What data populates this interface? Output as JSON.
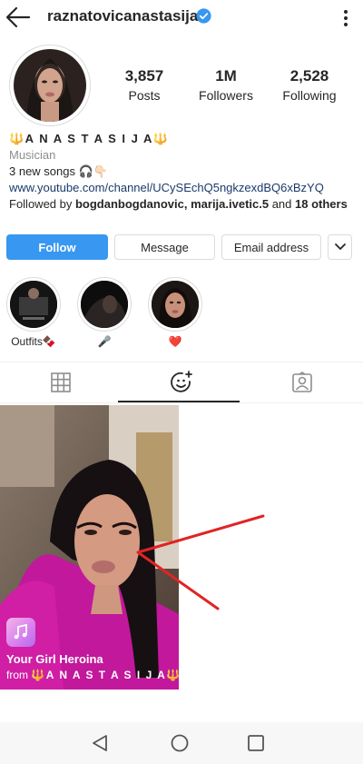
{
  "header": {
    "username": "raznatovicanastasija",
    "back_icon": "back-arrow-icon",
    "verified_icon": "verified-badge-icon",
    "menu_icon": "more-vertical-icon"
  },
  "stats": {
    "posts_count": "3,857",
    "posts_label": "Posts",
    "followers_count": "1M",
    "followers_label": "Followers",
    "following_count": "2,528",
    "following_label": "Following"
  },
  "bio": {
    "name": "🔱A N A S T A S I J A🔱",
    "category": "Musician",
    "text": "3 new songs 🎧👇🏻",
    "link": "www.youtube.com/channel/UCySEchQ5ngkzexdBQ6xBzYQ",
    "followed_prefix": "Followed by ",
    "followed_names": "bogdanbogdanovic, marija.ivetic.5",
    "followed_and": " and ",
    "followed_others": "18 others"
  },
  "buttons": {
    "follow": "Follow",
    "message": "Message",
    "email": "Email address",
    "more_icon": "chevron-down-icon"
  },
  "highlights": [
    {
      "label": "Outfits🍫"
    },
    {
      "label": "🎤"
    },
    {
      "label": "❤️"
    }
  ],
  "tabs": {
    "grid_icon": "grid-icon",
    "reels_icon": "reels-sparkle-icon",
    "tagged_icon": "tagged-person-icon",
    "active": "reels"
  },
  "post": {
    "title": "Your Girl Heroina",
    "from_prefix": "from ",
    "from_name": "🔱A N A S T A S I J A🔱"
  },
  "navbar": {
    "back_icon": "nav-back-icon",
    "home_icon": "nav-home-icon",
    "recent_icon": "nav-recent-icon"
  },
  "colors": {
    "follow_blue": "#3897f0",
    "link": "#1b3a6b",
    "muted": "#8e8e8e",
    "verified": "#3897f0",
    "annotation_red": "#e02424"
  }
}
